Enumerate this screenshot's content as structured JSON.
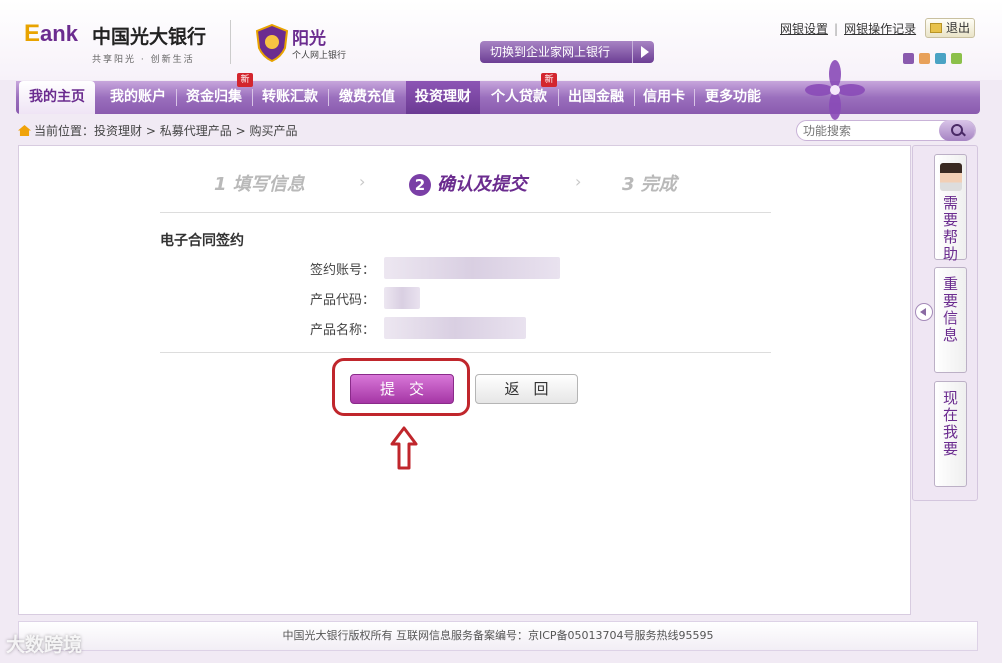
{
  "brand": {
    "logo_e": "E",
    "logo_ank": "ank",
    "bank_name": "中国光大银行",
    "slogan": "共享阳光 · 创新生活",
    "sun_brand": "阳光",
    "sun_sub": "个人网上银行"
  },
  "header": {
    "switch_label": "切换到企业家网上银行",
    "links": [
      "网银设置",
      "网银操作记录"
    ],
    "logout": "退出",
    "theme_colors": [
      "#8a5aae",
      "#e8a15a",
      "#4aa3c4",
      "#8cc04a"
    ]
  },
  "nav": {
    "items": [
      "我的主页",
      "我的账户",
      "资金归集",
      "转账汇款",
      "缴费充值",
      "投资理财",
      "个人贷款",
      "出国金融",
      "信用卡",
      "更多功能"
    ],
    "new_badge": "新",
    "active": "投资理财"
  },
  "breadcrumb": {
    "prefix": "当前位置：",
    "items": [
      "投资理财",
      "私募代理产品",
      "购买产品"
    ],
    "separator": ">"
  },
  "search": {
    "placeholder": "功能搜索"
  },
  "steps": {
    "step1": "1 填写信息",
    "step2_num": "2",
    "step2": "确认及提交",
    "step3": "3 完成",
    "chevron": "›"
  },
  "form": {
    "section_title": "电子合同签约",
    "fields": [
      {
        "label": "签约账号："
      },
      {
        "label": "产品代码："
      },
      {
        "label": "产品名称："
      }
    ],
    "submit": "提交",
    "back": "返回"
  },
  "sidebar": {
    "help": "需要帮助",
    "important": "重要信息",
    "want": "现在我要"
  },
  "footer": {
    "text": "中国光大银行版权所有 互联网信息服务备案编号：京ICP备05013704号服务热线95595"
  },
  "watermark": "大数跨境"
}
